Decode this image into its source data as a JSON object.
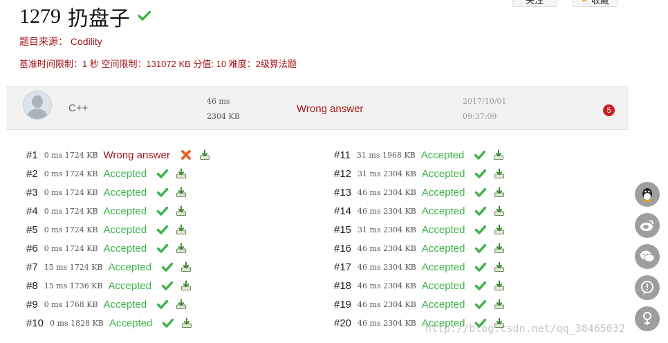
{
  "problem": {
    "number": "1279",
    "title": "扔盘子",
    "source_label": "题目来源：",
    "source": "Codility",
    "limits": "基准时间限制：1 秒 空间限制：131072 KB 分值: 10 难度：2级算法题"
  },
  "top_buttons": {
    "follow": "关注",
    "favorite": "收藏"
  },
  "submission": {
    "language": "C++",
    "time": "46 ms",
    "memory": "2304 KB",
    "verdict": "Wrong answer",
    "date": "2017/10/01",
    "clock": "09:37:09",
    "badge": "5"
  },
  "tests": [
    {
      "id": "#1",
      "stats": "0 ms 1724 KB",
      "result": "Wrong answer",
      "status": "wa"
    },
    {
      "id": "#2",
      "stats": "0 ms 1724 KB",
      "result": "Accepted",
      "status": "ac"
    },
    {
      "id": "#3",
      "stats": "0 ms 1724 KB",
      "result": "Accepted",
      "status": "ac"
    },
    {
      "id": "#4",
      "stats": "0 ms 1724 KB",
      "result": "Accepted",
      "status": "ac"
    },
    {
      "id": "#5",
      "stats": "0 ms 1724 KB",
      "result": "Accepted",
      "status": "ac"
    },
    {
      "id": "#6",
      "stats": "0 ms 1724 KB",
      "result": "Accepted",
      "status": "ac"
    },
    {
      "id": "#7",
      "stats": "15 ms 1724 KB",
      "result": "Accepted",
      "status": "ac"
    },
    {
      "id": "#8",
      "stats": "15 ms 1736 KB",
      "result": "Accepted",
      "status": "ac"
    },
    {
      "id": "#9",
      "stats": "0 ms 1768 KB",
      "result": "Accepted",
      "status": "ac"
    },
    {
      "id": "#10",
      "stats": "0 ms 1828 KB",
      "result": "Accepted",
      "status": "ac"
    },
    {
      "id": "#11",
      "stats": "31 ms 1968 KB",
      "result": "Accepted",
      "status": "ac"
    },
    {
      "id": "#12",
      "stats": "31 ms 2304 KB",
      "result": "Accepted",
      "status": "ac"
    },
    {
      "id": "#13",
      "stats": "46 ms 2304 KB",
      "result": "Accepted",
      "status": "ac"
    },
    {
      "id": "#14",
      "stats": "46 ms 2304 KB",
      "result": "Accepted",
      "status": "ac"
    },
    {
      "id": "#15",
      "stats": "31 ms 2304 KB",
      "result": "Accepted",
      "status": "ac"
    },
    {
      "id": "#16",
      "stats": "46 ms 2304 KB",
      "result": "Accepted",
      "status": "ac"
    },
    {
      "id": "#17",
      "stats": "46 ms 2304 KB",
      "result": "Accepted",
      "status": "ac"
    },
    {
      "id": "#18",
      "stats": "46 ms 2304 KB",
      "result": "Accepted",
      "status": "ac"
    },
    {
      "id": "#19",
      "stats": "46 ms 2304 KB",
      "result": "Accepted",
      "status": "ac"
    },
    {
      "id": "#20",
      "stats": "46 ms 2304 KB",
      "result": "Accepted",
      "status": "ac"
    }
  ],
  "side_buttons": [
    "qq-icon",
    "weibo-icon",
    "wechat-icon",
    "comment-icon",
    "share-icon"
  ],
  "watermark": "http://blog.csdn.net/qq_38465032",
  "colors": {
    "accepted": "#3cb34a",
    "wrong": "#a31515",
    "badge": "#cc1f1f",
    "summary_bg": "#f2f2f2"
  }
}
